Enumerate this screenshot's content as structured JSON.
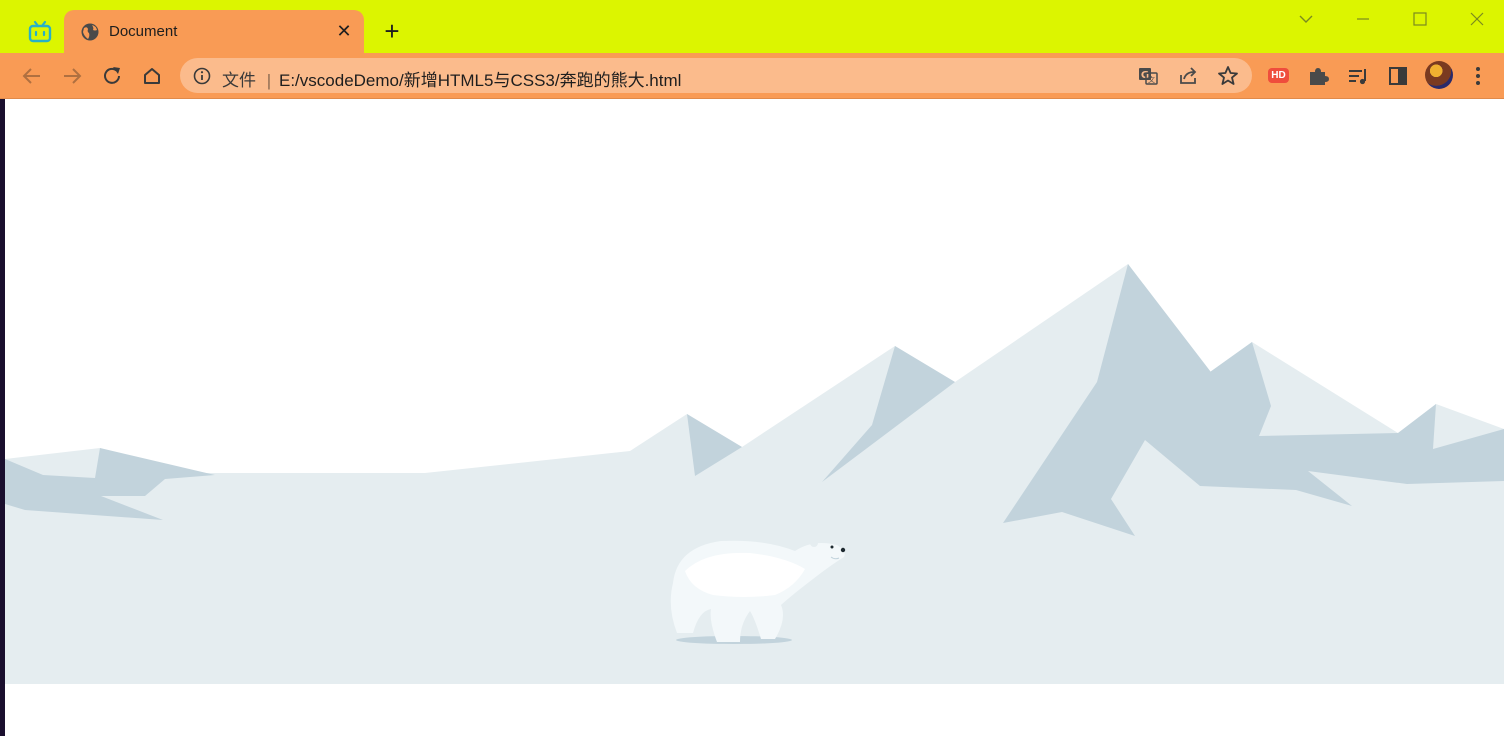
{
  "browser": {
    "tab": {
      "title": "Document",
      "favicon": "globe-icon"
    },
    "app_icon": "bilibili-tv-icon",
    "address_bar": {
      "scheme_label": "文件",
      "separator": "|",
      "url": "E:/vscodeDemo/新增HTML5与CSS3/奔跑的熊大.html"
    },
    "extension_badge": "HD",
    "colors": {
      "tabstrip": "#dcf500",
      "toolbar": "#f99b55",
      "omnibox": "#fbbb8c"
    }
  },
  "page": {
    "scene": "snowy-mountains-with-running-polar-bear",
    "colors": {
      "sky": "#ffffff",
      "snow": "#e5edf0",
      "mountain_shadow": "#c2d3dc",
      "bear": "#f7fbfc"
    }
  }
}
